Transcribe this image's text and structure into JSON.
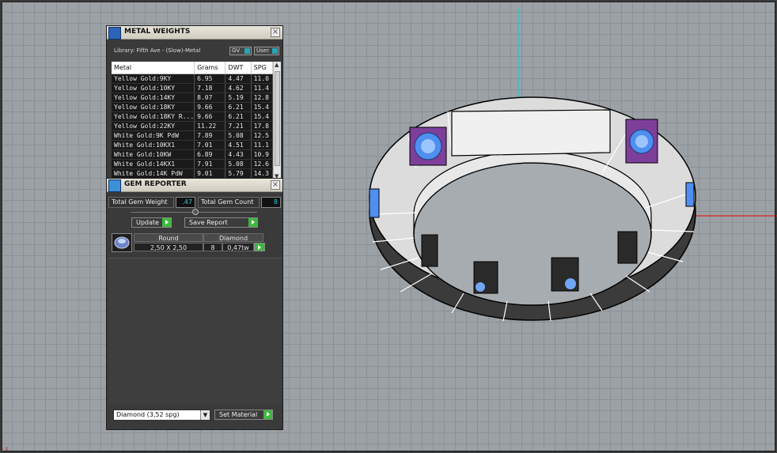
{
  "viewport": {
    "axis_colors": {
      "x": "#e02020",
      "z": "#20c8d0"
    },
    "corner_axis": "-x"
  },
  "metal_weights": {
    "title": "METAL WEIGHTS",
    "library": "Library: Fifth Ave - (Slow)-Metal",
    "toggle_gv": "GV",
    "toggle_user": "User",
    "columns": [
      "Metal",
      "Grams",
      "DWT",
      "SPG"
    ],
    "rows": [
      [
        "Yellow Gold:9KY",
        "6.95",
        "4.47",
        "11.0"
      ],
      [
        "Yellow Gold:10KY",
        "7.18",
        "4.62",
        "11.4"
      ],
      [
        "Yellow Gold:14KY",
        "8.07",
        "5.19",
        "12.8"
      ],
      [
        "Yellow Gold:18KY",
        "9.66",
        "6.21",
        "15.4"
      ],
      [
        "Yellow Gold:18KY R...",
        "9.66",
        "6.21",
        "15.4"
      ],
      [
        "Yellow Gold:22KY",
        "11.22",
        "7.21",
        "17.8"
      ],
      [
        "White Gold:9K PdW",
        "7.89",
        "5.08",
        "12.5"
      ],
      [
        "White Gold:10KX1",
        "7.01",
        "4.51",
        "11.1"
      ],
      [
        "White Gold:10KW",
        "6.89",
        "4.43",
        "10.9"
      ],
      [
        "White Gold:14KX1",
        "7.91",
        "5.08",
        "12.6"
      ],
      [
        "White Gold:14K PdW",
        "9.01",
        "5.79",
        "14.3"
      ]
    ]
  },
  "gem_reporter": {
    "title": "GEM REPORTER",
    "weight_label": "Total Gem Weight",
    "weight_value": ".47",
    "count_label": "Total Gem Count",
    "count_value": "8",
    "update_label": "Update",
    "save_label": "Save Report",
    "gem": {
      "cut_header": "Round",
      "cut_value": "2,50 X 2,50",
      "material_header": "Diamond",
      "count": "8",
      "weight": "0,47tw"
    },
    "material_select": "Diamond     (3,52 spg)",
    "set_material_label": "Set Material"
  }
}
